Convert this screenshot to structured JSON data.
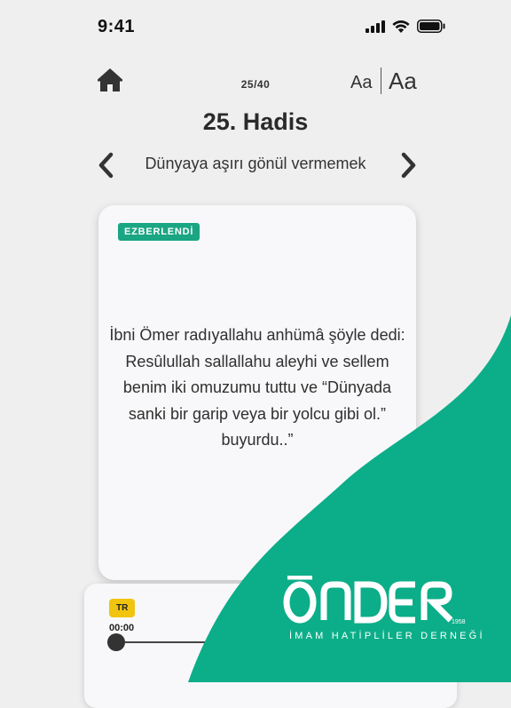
{
  "status_bar": {
    "time": "9:41"
  },
  "header": {
    "page_counter": "25/40",
    "font_small_label": "Aa",
    "font_large_label": "Aa"
  },
  "hadis": {
    "title": "25. Hadis",
    "subtitle": "Dünyaya aşırı gönül vermemek",
    "status_badge": "EZBERLENDİ",
    "text": "İbni Ömer radıyallahu anhümâ şöyle dedi: Resûlullah sallallahu aleyhi ve sellem benim iki omuzumu tuttu ve “Dünyada sanki bir garip veya bir yolcu gibi ol.” buyurdu..”"
  },
  "player": {
    "language_badge": "TR",
    "current_time": "00:00",
    "progress": 0
  },
  "brand": {
    "logo_text": "ÖNDER",
    "logo_year": "1958",
    "logo_subtitle": "İMAM HATİPLİLER DERNEĞİ"
  },
  "colors": {
    "accent_green": "#0bae88",
    "badge_green": "#1aa583",
    "badge_yellow": "#f1c40f",
    "background": "#efefef"
  },
  "icons": [
    "home-icon",
    "chevron-left-icon",
    "chevron-right-icon",
    "signal-icon",
    "wifi-icon",
    "battery-icon"
  ]
}
